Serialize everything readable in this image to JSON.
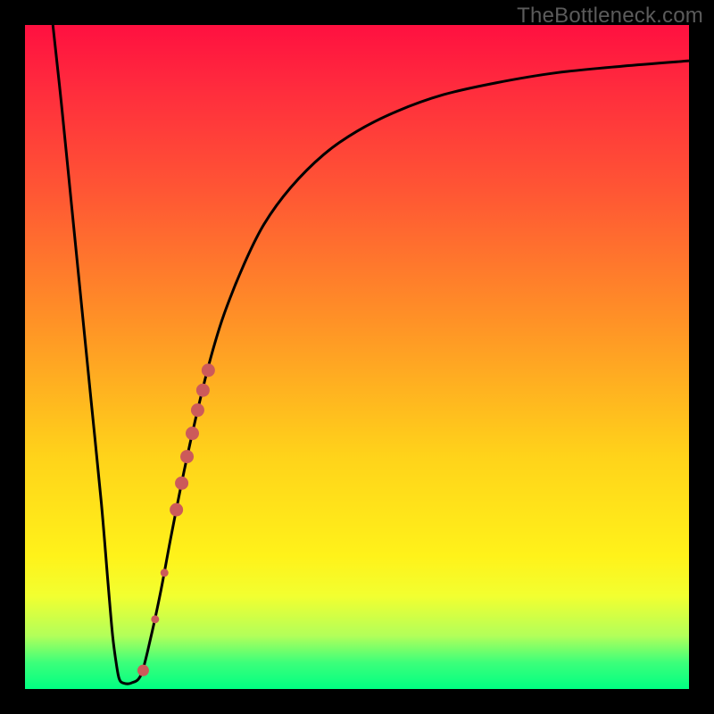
{
  "watermark": "TheBottleneck.com",
  "chart_data": {
    "type": "line",
    "title": "",
    "xlabel": "",
    "ylabel": "",
    "xlim": [
      0,
      100
    ],
    "ylim": [
      0,
      100
    ],
    "grid": false,
    "legend": false,
    "curve_points": [
      {
        "x": 4.2,
        "y": 100.0
      },
      {
        "x": 5.5,
        "y": 88.0
      },
      {
        "x": 7.0,
        "y": 73.0
      },
      {
        "x": 8.5,
        "y": 58.0
      },
      {
        "x": 10.0,
        "y": 43.0
      },
      {
        "x": 11.5,
        "y": 28.0
      },
      {
        "x": 12.5,
        "y": 16.0
      },
      {
        "x": 13.2,
        "y": 8.0
      },
      {
        "x": 13.8,
        "y": 3.5
      },
      {
        "x": 14.2,
        "y": 1.5
      },
      {
        "x": 14.8,
        "y": 0.9
      },
      {
        "x": 16.0,
        "y": 0.9
      },
      {
        "x": 17.5,
        "y": 2.2
      },
      {
        "x": 19.0,
        "y": 8.0
      },
      {
        "x": 20.5,
        "y": 15.0
      },
      {
        "x": 22.0,
        "y": 23.0
      },
      {
        "x": 24.0,
        "y": 33.0
      },
      {
        "x": 26.0,
        "y": 42.0
      },
      {
        "x": 28.0,
        "y": 50.0
      },
      {
        "x": 30.0,
        "y": 56.5
      },
      {
        "x": 33.0,
        "y": 64.0
      },
      {
        "x": 36.0,
        "y": 70.0
      },
      {
        "x": 40.0,
        "y": 75.5
      },
      {
        "x": 45.0,
        "y": 80.5
      },
      {
        "x": 50.0,
        "y": 84.0
      },
      {
        "x": 56.0,
        "y": 87.0
      },
      {
        "x": 63.0,
        "y": 89.5
      },
      {
        "x": 71.0,
        "y": 91.3
      },
      {
        "x": 80.0,
        "y": 92.8
      },
      {
        "x": 90.0,
        "y": 93.8
      },
      {
        "x": 100.0,
        "y": 94.6
      }
    ],
    "data_points": [
      {
        "x": 17.8,
        "y": 2.8,
        "r": 6.5
      },
      {
        "x": 19.6,
        "y": 10.5,
        "r": 4.5
      },
      {
        "x": 21.0,
        "y": 17.5,
        "r": 4.5
      },
      {
        "x": 22.8,
        "y": 27.0,
        "r": 7.5
      },
      {
        "x": 23.6,
        "y": 31.0,
        "r": 7.5
      },
      {
        "x": 24.4,
        "y": 35.0,
        "r": 7.5
      },
      {
        "x": 25.2,
        "y": 38.5,
        "r": 7.5
      },
      {
        "x": 26.0,
        "y": 42.0,
        "r": 7.5
      },
      {
        "x": 26.8,
        "y": 45.0,
        "r": 7.5
      },
      {
        "x": 27.6,
        "y": 48.0,
        "r": 7.5
      }
    ],
    "gradient_stops": [
      {
        "pos": 0.0,
        "color": "#ff1040"
      },
      {
        "pos": 0.1,
        "color": "#ff2d3d"
      },
      {
        "pos": 0.25,
        "color": "#ff5634"
      },
      {
        "pos": 0.45,
        "color": "#ff9326"
      },
      {
        "pos": 0.65,
        "color": "#ffd31a"
      },
      {
        "pos": 0.8,
        "color": "#fff21a"
      },
      {
        "pos": 0.86,
        "color": "#f2ff30"
      },
      {
        "pos": 0.92,
        "color": "#b2ff5a"
      },
      {
        "pos": 0.96,
        "color": "#3dff7a"
      },
      {
        "pos": 1.0,
        "color": "#00ff82"
      }
    ]
  }
}
